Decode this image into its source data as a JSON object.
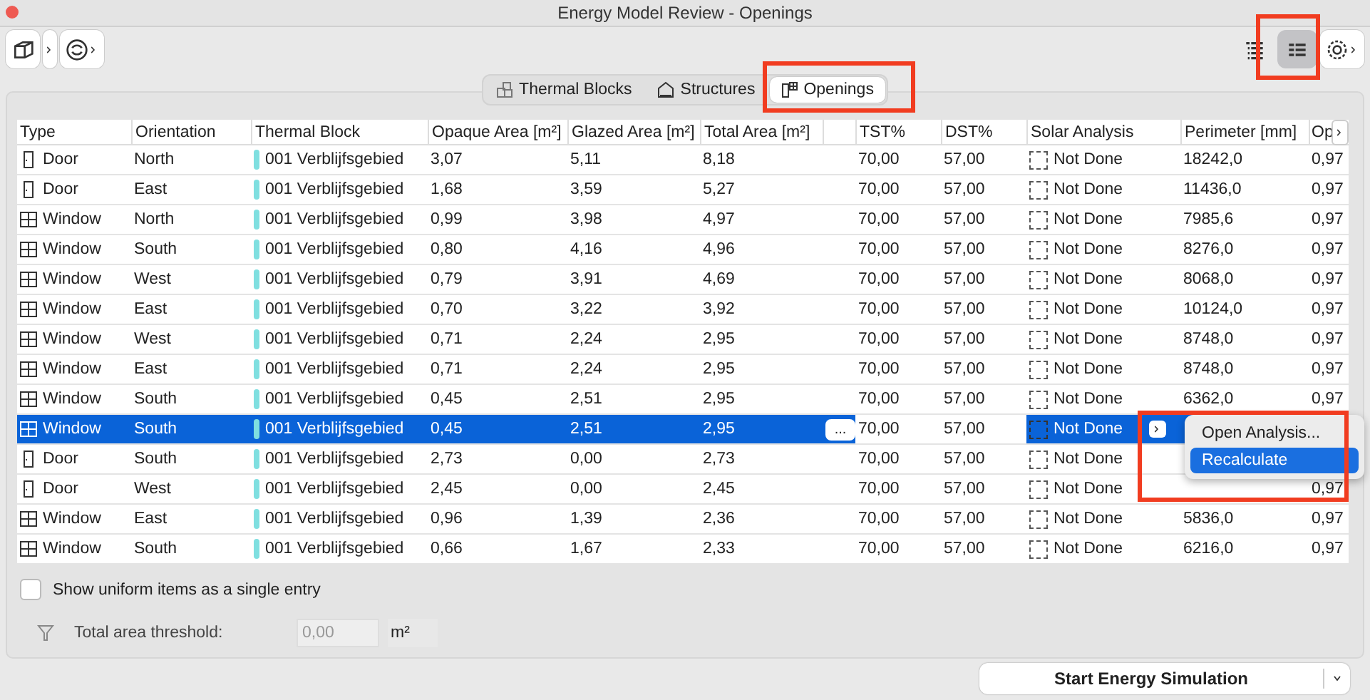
{
  "window": {
    "title": "Energy Model Review - Openings"
  },
  "view_buttons": [
    {
      "selected": false
    },
    {
      "selected": true
    }
  ],
  "tabs": [
    {
      "label": "Thermal Blocks",
      "selected": false,
      "kind": "blocks"
    },
    {
      "label": "Structures",
      "selected": false,
      "kind": "structures"
    },
    {
      "label": "Openings",
      "selected": true,
      "kind": "openings"
    }
  ],
  "table": {
    "columns": [
      "Type",
      "Orientation",
      "Thermal Block",
      "Opaque Area [m²]",
      "Glazed Area [m²]",
      "Total Area [m²]",
      "",
      "TST%",
      "DST%",
      "Solar Analysis",
      "Perimeter [mm]",
      "Op"
    ],
    "rows": [
      {
        "kind": "door",
        "type": "Door",
        "orientation": "North",
        "thermal_block": "001 Verblijfsgebied",
        "opaque": "3,07",
        "glazed": "5,11",
        "total": "8,18",
        "tst": "70,00",
        "dst": "57,00",
        "solar": "Not Done",
        "perimeter": "18242,0",
        "op": "0,97",
        "selected": false
      },
      {
        "kind": "door",
        "type": "Door",
        "orientation": "East",
        "thermal_block": "001 Verblijfsgebied",
        "opaque": "1,68",
        "glazed": "3,59",
        "total": "5,27",
        "tst": "70,00",
        "dst": "57,00",
        "solar": "Not Done",
        "perimeter": "11436,0",
        "op": "0,97",
        "selected": false
      },
      {
        "kind": "window",
        "type": "Window",
        "orientation": "North",
        "thermal_block": "001 Verblijfsgebied",
        "opaque": "0,99",
        "glazed": "3,98",
        "total": "4,97",
        "tst": "70,00",
        "dst": "57,00",
        "solar": "Not Done",
        "perimeter": "7985,6",
        "op": "0,97",
        "selected": false
      },
      {
        "kind": "window",
        "type": "Window",
        "orientation": "South",
        "thermal_block": "001 Verblijfsgebied",
        "opaque": "0,80",
        "glazed": "4,16",
        "total": "4,96",
        "tst": "70,00",
        "dst": "57,00",
        "solar": "Not Done",
        "perimeter": "8276,0",
        "op": "0,97",
        "selected": false
      },
      {
        "kind": "window",
        "type": "Window",
        "orientation": "West",
        "thermal_block": "001 Verblijfsgebied",
        "opaque": "0,79",
        "glazed": "3,91",
        "total": "4,69",
        "tst": "70,00",
        "dst": "57,00",
        "solar": "Not Done",
        "perimeter": "8068,0",
        "op": "0,97",
        "selected": false
      },
      {
        "kind": "window",
        "type": "Window",
        "orientation": "East",
        "thermal_block": "001 Verblijfsgebied",
        "opaque": "0,70",
        "glazed": "3,22",
        "total": "3,92",
        "tst": "70,00",
        "dst": "57,00",
        "solar": "Not Done",
        "perimeter": "10124,0",
        "op": "0,97",
        "selected": false
      },
      {
        "kind": "window",
        "type": "Window",
        "orientation": "West",
        "thermal_block": "001 Verblijfsgebied",
        "opaque": "0,71",
        "glazed": "2,24",
        "total": "2,95",
        "tst": "70,00",
        "dst": "57,00",
        "solar": "Not Done",
        "perimeter": "8748,0",
        "op": "0,97",
        "selected": false
      },
      {
        "kind": "window",
        "type": "Window",
        "orientation": "East",
        "thermal_block": "001 Verblijfsgebied",
        "opaque": "0,71",
        "glazed": "2,24",
        "total": "2,95",
        "tst": "70,00",
        "dst": "57,00",
        "solar": "Not Done",
        "perimeter": "8748,0",
        "op": "0,97",
        "selected": false
      },
      {
        "kind": "window",
        "type": "Window",
        "orientation": "South",
        "thermal_block": "001 Verblijfsgebied",
        "opaque": "0,45",
        "glazed": "2,51",
        "total": "2,95",
        "tst": "70,00",
        "dst": "57,00",
        "solar": "Not Done",
        "perimeter": "6362,0",
        "op": "0,97",
        "selected": false
      },
      {
        "kind": "window",
        "type": "Window",
        "orientation": "South",
        "thermal_block": "001 Verblijfsgebied",
        "opaque": "0,45",
        "glazed": "2,51",
        "total": "2,95",
        "tst": "70,00",
        "dst": "57,00",
        "solar": "Not Done",
        "selected": true
      },
      {
        "kind": "door",
        "type": "Door",
        "orientation": "South",
        "thermal_block": "001 Verblijfsgebied",
        "opaque": "2,73",
        "glazed": "0,00",
        "total": "2,73",
        "tst": "70,00",
        "dst": "57,00",
        "solar": "Not Done",
        "selected": false
      },
      {
        "kind": "door",
        "type": "Door",
        "orientation": "West",
        "thermal_block": "001 Verblijfsgebied",
        "opaque": "2,45",
        "glazed": "0,00",
        "total": "2,45",
        "tst": "70,00",
        "dst": "57,00",
        "solar": "Not Done",
        "op": "0,97",
        "selected": false
      },
      {
        "kind": "window",
        "type": "Window",
        "orientation": "East",
        "thermal_block": "001 Verblijfsgebied",
        "opaque": "0,96",
        "glazed": "1,39",
        "total": "2,36",
        "tst": "70,00",
        "dst": "57,00",
        "solar": "Not Done",
        "perimeter": "5836,0",
        "op": "0,97",
        "selected": false
      },
      {
        "kind": "window",
        "type": "Window",
        "orientation": "South",
        "thermal_block": "001 Verblijfsgebied",
        "opaque": "0,66",
        "glazed": "1,67",
        "total": "2,33",
        "tst": "70,00",
        "dst": "57,00",
        "solar": "Not Done",
        "perimeter": "6216,0",
        "op": "0,97",
        "selected": false
      }
    ]
  },
  "edit_button": {
    "label": "..."
  },
  "context_menu": {
    "items": [
      {
        "label": "Open Analysis...",
        "selected": false
      },
      {
        "label": "Recalculate",
        "selected": true
      }
    ]
  },
  "uniform_option": {
    "label": "Show uniform items as a single entry",
    "checked": false
  },
  "threshold": {
    "label": "Total area threshold:",
    "value": "0,00",
    "unit": "m²",
    "disabled": true
  },
  "start_button": {
    "label": "Start Energy Simulation"
  }
}
